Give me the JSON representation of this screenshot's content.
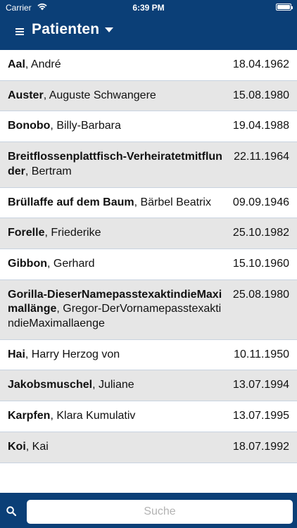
{
  "status": {
    "carrier": "Carrier",
    "time": "6:39 PM"
  },
  "header": {
    "title": "Patienten"
  },
  "patients": [
    {
      "last": "Aal",
      "first": ", André",
      "date": "18.04.1962"
    },
    {
      "last": "Auster",
      "first": ", Auguste Schwangere",
      "date": "15.08.1980"
    },
    {
      "last": "Bonobo",
      "first": ", Billy-Barbara",
      "date": "19.04.1988"
    },
    {
      "last": "Breitflossenplattfisch-Verheiratetmitflunder",
      "first": ", Bertram",
      "date": "22.11.1964"
    },
    {
      "last": "Brüllaffe auf dem Baum",
      "first": ", Bärbel Beatrix",
      "date": "09.09.1946"
    },
    {
      "last": "Forelle",
      "first": ", Friederike",
      "date": "25.10.1982"
    },
    {
      "last": "Gibbon",
      "first": ", Gerhard",
      "date": "15.10.1960"
    },
    {
      "last": "Gorilla-DieserNamepasstexaktindieMaximallänge",
      "first": ", Gregor-DerVornamepasstexaktindieMaximallaenge",
      "date": "25.08.1980"
    },
    {
      "last": "Hai",
      "first": ", Harry Herzog von",
      "date": "10.11.1950"
    },
    {
      "last": "Jakobsmuschel",
      "first": ", Juliane",
      "date": "13.07.1994"
    },
    {
      "last": "Karpfen",
      "first": ", Klara Kumulativ",
      "date": "13.07.1995"
    },
    {
      "last": "Koi",
      "first": ", Kai",
      "date": "18.07.1992"
    }
  ],
  "search": {
    "placeholder": "Suche"
  },
  "colors": {
    "bar": "#0b3f77",
    "row_alt": "#e6e6e6"
  }
}
